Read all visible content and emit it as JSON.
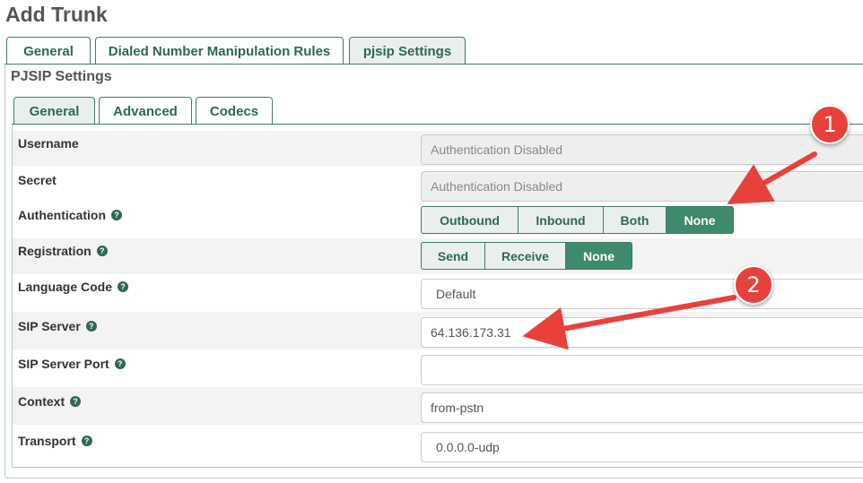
{
  "page": {
    "title": "Add Trunk"
  },
  "top_tabs": [
    {
      "label": "General",
      "active": false
    },
    {
      "label": "Dialed Number Manipulation Rules",
      "active": false
    },
    {
      "label": "pjsip Settings",
      "active": true
    }
  ],
  "section": {
    "title": "PJSIP Settings"
  },
  "sub_tabs": [
    {
      "label": "General",
      "active": true
    },
    {
      "label": "Advanced",
      "active": false
    },
    {
      "label": "Codecs",
      "active": false
    }
  ],
  "fields": {
    "username": {
      "label": "Username",
      "value": "Authentication Disabled"
    },
    "secret": {
      "label": "Secret",
      "value": "Authentication Disabled"
    },
    "authentication": {
      "label": "Authentication",
      "options": [
        "Outbound",
        "Inbound",
        "Both",
        "None"
      ],
      "selected": "None"
    },
    "registration": {
      "label": "Registration",
      "options": [
        "Send",
        "Receive",
        "None"
      ],
      "selected": "None"
    },
    "language_code": {
      "label": "Language Code",
      "value": "Default"
    },
    "sip_server": {
      "label": "SIP Server",
      "value": "64.136.173.31"
    },
    "sip_server_port": {
      "label": "SIP Server Port",
      "value": ""
    },
    "context": {
      "label": "Context",
      "value": "from-pstn"
    },
    "transport": {
      "label": "Transport",
      "value": "0.0.0.0-udp"
    }
  },
  "help_icon": "?",
  "annotations": [
    {
      "number": "1",
      "color": "#e8413c"
    },
    {
      "number": "2",
      "color": "#e8413c"
    }
  ],
  "colors": {
    "accent": "#3f8a6d",
    "tab_text": "#2e6854",
    "annotation": "#e8413c"
  }
}
